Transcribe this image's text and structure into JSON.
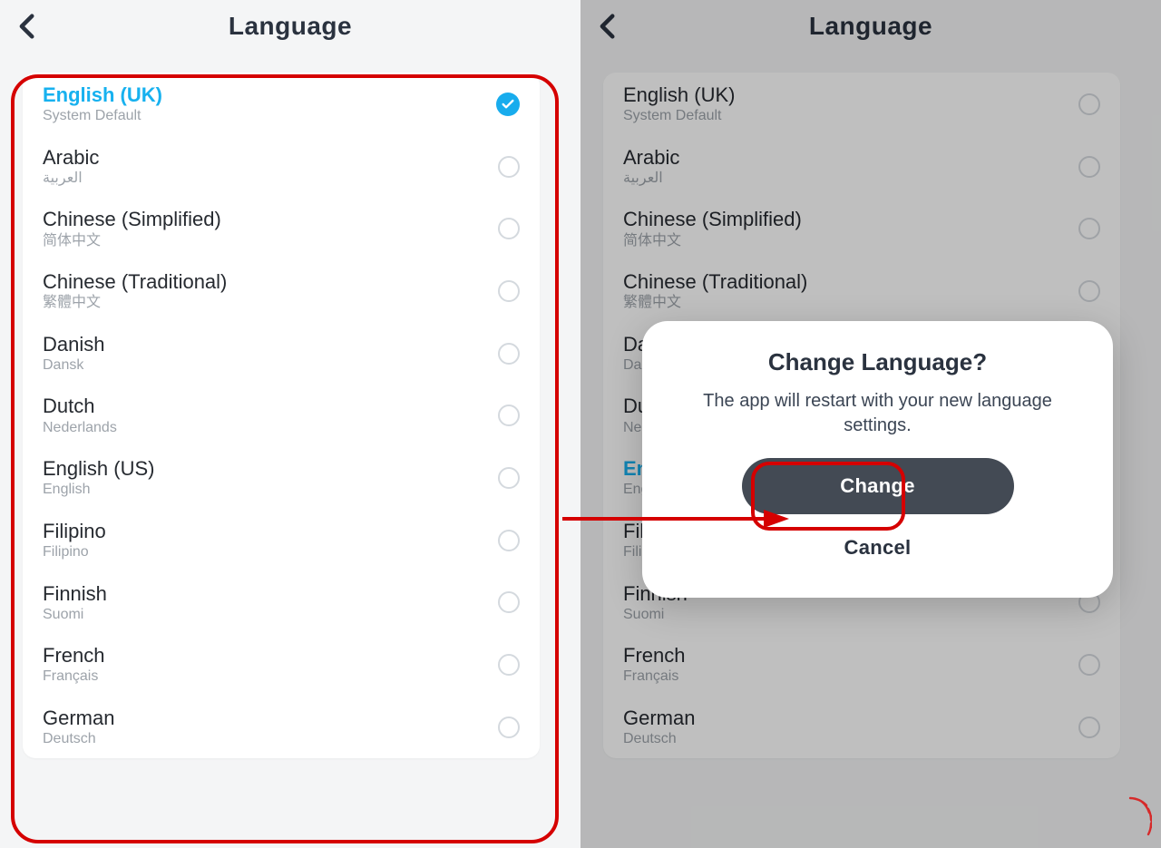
{
  "header": {
    "title": "Language"
  },
  "list_left": {
    "selected_index": 0,
    "items": [
      {
        "name": "English (UK)",
        "sub": "System Default"
      },
      {
        "name": "Arabic",
        "sub": "العربية"
      },
      {
        "name": "Chinese (Simplified)",
        "sub": "简体中文"
      },
      {
        "name": "Chinese (Traditional)",
        "sub": "繁體中文"
      },
      {
        "name": "Danish",
        "sub": "Dansk"
      },
      {
        "name": "Dutch",
        "sub": "Nederlands"
      },
      {
        "name": "English (US)",
        "sub": "English"
      },
      {
        "name": "Filipino",
        "sub": "Filipino"
      },
      {
        "name": "Finnish",
        "sub": "Suomi"
      },
      {
        "name": "French",
        "sub": "Français"
      },
      {
        "name": "German",
        "sub": "Deutsch"
      }
    ]
  },
  "list_right": {
    "selected_index": 6,
    "items": [
      {
        "name": "English (UK)",
        "sub": "System Default"
      },
      {
        "name": "Arabic",
        "sub": "العربية"
      },
      {
        "name": "Chinese (Simplified)",
        "sub": "简体中文"
      },
      {
        "name": "Chinese (Traditional)",
        "sub": "繁體中文"
      },
      {
        "name": "Danish",
        "sub": "Dansk"
      },
      {
        "name": "Dutch",
        "sub": "Nederlands"
      },
      {
        "name": "English (US)",
        "sub": "English"
      },
      {
        "name": "Filipino",
        "sub": "Filipino"
      },
      {
        "name": "Finnish",
        "sub": "Suomi"
      },
      {
        "name": "French",
        "sub": "Français"
      },
      {
        "name": "German",
        "sub": "Deutsch"
      }
    ]
  },
  "dialog": {
    "title": "Change Language?",
    "message": "The app will restart with your new language settings.",
    "primary": "Change",
    "secondary": "Cancel"
  },
  "colors": {
    "accent": "#18aced",
    "annotation": "#d50000",
    "dark_button": "#434a54"
  }
}
